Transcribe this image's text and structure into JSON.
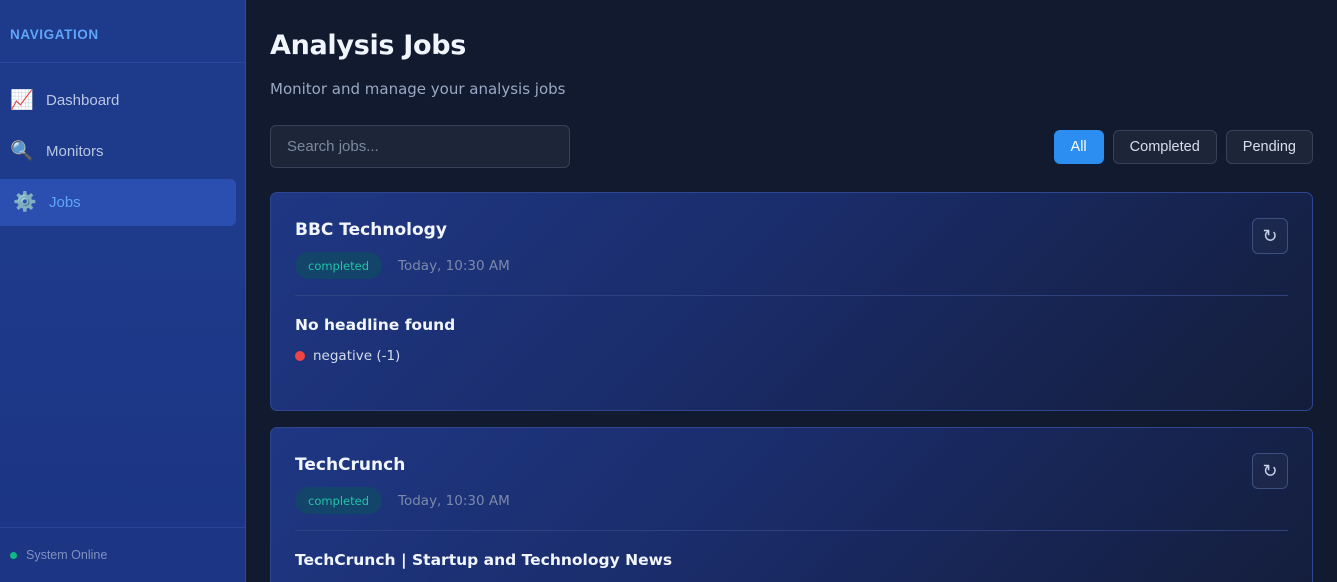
{
  "sidebar": {
    "header": "NAVIGATION",
    "items": [
      {
        "icon": "📈",
        "label": "Dashboard",
        "active": false
      },
      {
        "icon": "🔍",
        "label": "Monitors",
        "active": false
      },
      {
        "icon": "⚙️",
        "label": "Jobs",
        "active": true
      }
    ],
    "footer_status": "System Online"
  },
  "page": {
    "title": "Analysis Jobs",
    "subtitle": "Monitor and manage your analysis jobs"
  },
  "search": {
    "placeholder": "Search jobs...",
    "value": ""
  },
  "filters": [
    {
      "label": "All",
      "active": true
    },
    {
      "label": "Completed",
      "active": false
    },
    {
      "label": "Pending",
      "active": false
    }
  ],
  "jobs": [
    {
      "name": "BBC Technology",
      "status": "completed",
      "time": "Today, 10:30 AM",
      "refresh_icon": "↻",
      "headline": "No headline found",
      "sentiment": "negative (-1)",
      "sentiment_color": "#ef4444"
    },
    {
      "name": "TechCrunch",
      "status": "completed",
      "time": "Today, 10:30 AM",
      "refresh_icon": "↻",
      "headline": "TechCrunch | Startup and Technology News"
    }
  ],
  "colors": {
    "accent": "#2b8ef0",
    "nav_active": "#60a5fa",
    "status_completed": "#22c3a6",
    "online": "#10b981"
  }
}
